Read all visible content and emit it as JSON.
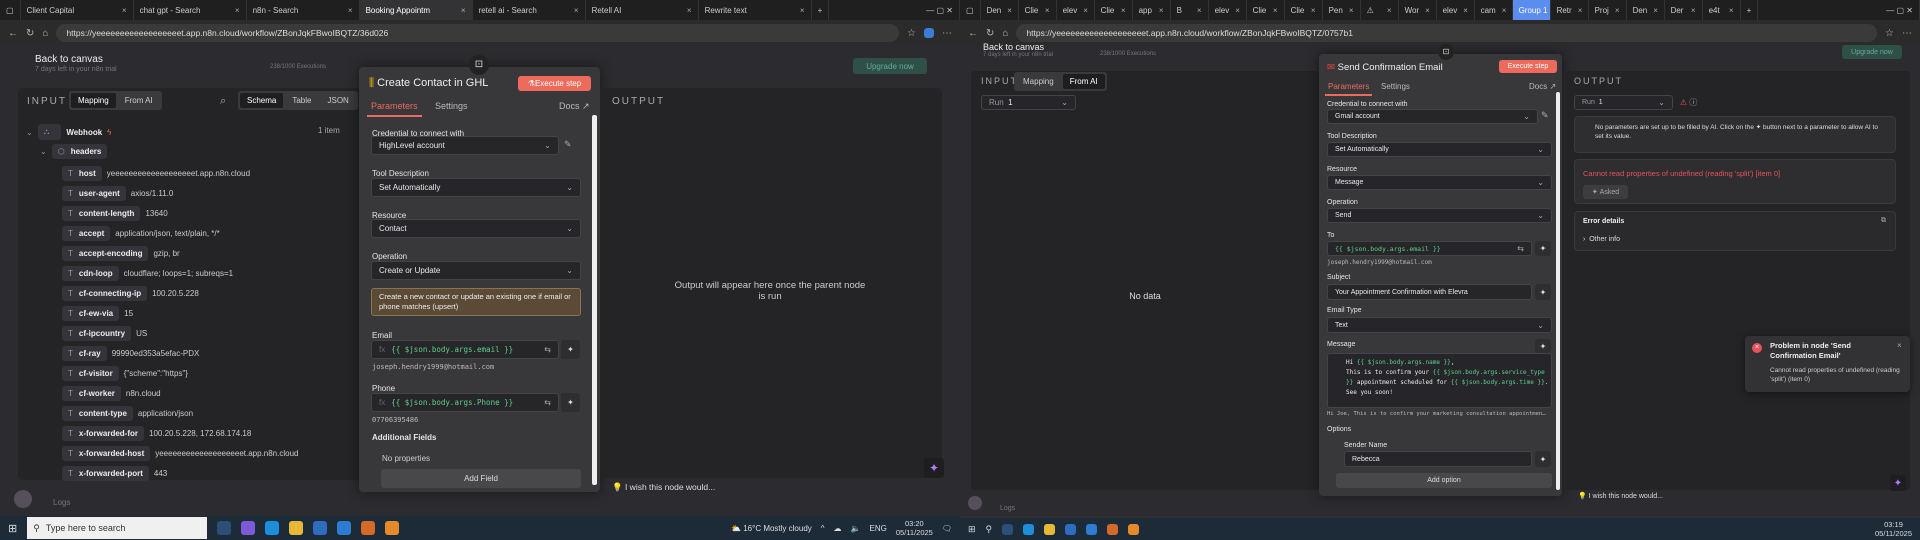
{
  "left": {
    "tabs": [
      {
        "label": "Client Capital"
      },
      {
        "label": "chat gpt - Search"
      },
      {
        "label": "n8n - Search"
      },
      {
        "label": "Booking Appointm"
      },
      {
        "label": "retell ai - Search"
      },
      {
        "label": "Retell AI"
      },
      {
        "label": "Rewrite text"
      }
    ],
    "url": "https://yeeeeeeeeeeeeeeeeeet.app.n8n.cloud/workflow/ZBonJqkFBwoIBQTZ/36d026",
    "back": "Back to canvas",
    "trial": "7 days left in your n8n trial",
    "executions": "238/1000 Executions",
    "upgrade": "Upgrade now",
    "input": {
      "title": "INPUT",
      "mapping": "Mapping",
      "from_ai": "From AI",
      "schema": "Schema",
      "table": "Table",
      "json": "JSON",
      "webhook": "Webhook",
      "items": "1 item",
      "headers": "headers",
      "rows": [
        [
          "host",
          "yeeeeeeeeeeeeeeeeeeet.app.n8n.cloud"
        ],
        [
          "user-agent",
          "axios/1.11.0"
        ],
        [
          "content-length",
          "13640"
        ],
        [
          "accept",
          "application/json, text/plain, */*"
        ],
        [
          "accept-encoding",
          "gzip, br"
        ],
        [
          "cdn-loop",
          "cloudflare; loops=1; subreqs=1"
        ],
        [
          "cf-connecting-ip",
          "100.20.5.228"
        ],
        [
          "cf-ew-via",
          "15"
        ],
        [
          "cf-ipcountry",
          "US"
        ],
        [
          "cf-ray",
          "99990ed353a5efac-PDX"
        ],
        [
          "cf-visitor",
          "{\"scheme\":\"https\"}"
        ],
        [
          "cf-worker",
          "n8n.cloud"
        ],
        [
          "content-type",
          "application/json"
        ],
        [
          "x-forwarded-for",
          "100.20.5.228, 172.68.174.18"
        ],
        [
          "x-forwarded-host",
          "yeeeeeeeeeeeeeeeeeeet.app.n8n.cloud"
        ],
        [
          "x-forwarded-port",
          "443"
        ]
      ]
    },
    "node": {
      "title": "Create Contact in GHL",
      "execute": "Execute step",
      "tab_params": "Parameters",
      "tab_settings": "Settings",
      "docs": "Docs",
      "cred_label": "Credential to connect with",
      "cred": "HighLevel account",
      "tool_label": "Tool Description",
      "tool": "Set Automatically",
      "resource_label": "Resource",
      "resource": "Contact",
      "op_label": "Operation",
      "op": "Create or Update",
      "notice": "Create a new contact or update an existing one if email or phone matches (upsert)",
      "email_label": "Email",
      "email_expr": "{{ $json.body.args.email }}",
      "email_hint": "joseph.hendry1999@hotmail.com",
      "phone_label": "Phone",
      "phone_expr": "{{ $json.body.args.Phone }}",
      "phone_hint": "07706395486",
      "additional": "Additional Fields",
      "no_props": "No properties",
      "add_field": "Add Field"
    },
    "output": {
      "title": "OUTPUT",
      "placeholder": "Output will appear here once the parent node is run",
      "wish": "I wish this node would..."
    },
    "logs": "Logs",
    "taskbar": {
      "search": "Type here to search",
      "weather": "16°C  Mostly cloudy",
      "lang": "ENG",
      "time": "03:20",
      "date": "05/11/2025"
    }
  },
  "right": {
    "tabs": [
      {
        "label": "Den"
      },
      {
        "label": "Clie"
      },
      {
        "label": "elev"
      },
      {
        "label": "Clie"
      },
      {
        "label": "app"
      },
      {
        "label": "B"
      },
      {
        "label": "elev"
      },
      {
        "label": "Clie"
      },
      {
        "label": "Clie"
      },
      {
        "label": "Pen"
      },
      {
        "label": "⚠"
      },
      {
        "label": "Wor"
      },
      {
        "label": "elev"
      },
      {
        "label": "cam"
      },
      {
        "label": "Group 1"
      },
      {
        "label": "Retr"
      },
      {
        "label": "Proj"
      },
      {
        "label": "Den"
      },
      {
        "label": "Der"
      },
      {
        "label": "e4t"
      }
    ],
    "url": "https://yeeeeeeeeeeeeeeeeeeet.app.n8n.cloud/workflow/ZBonJqkFBwoIBQTZ/0757b1",
    "back": "Back to canvas",
    "trial": "7 days left in your n8n trial",
    "executions": "238/1000 Executions",
    "upgrade": "Upgrade now",
    "input": {
      "title": "INPUT",
      "mapping": "Mapping",
      "from_ai": "From AI",
      "run_label": "Run",
      "run": "1",
      "no_data": "No data"
    },
    "node": {
      "title": "Send Confirmation Email",
      "execute": "Execute step",
      "tab_params": "Parameters",
      "tab_settings": "Settings",
      "docs": "Docs",
      "cred_label": "Credential to connect with",
      "cred": "Gmail account",
      "tool_label": "Tool Description",
      "tool": "Set Automatically",
      "resource_label": "Resource",
      "resource": "Message",
      "op_label": "Operation",
      "op": "Send",
      "to_label": "To",
      "to_expr": "{{ $json.body.args.email }}",
      "to_hint": "joseph.hendry1999@hotmail.com",
      "subject_label": "Subject",
      "subject": "Your Appointment Confirmation with Elevra",
      "type_label": "Email Type",
      "type": "Text",
      "message_label": "Message",
      "msg": {
        "l1a": "Hi ",
        "l1b": "{{ $json.body.args.name }}",
        "l1c": ",",
        "l2a": "This is to confirm your ",
        "l2b": "{{ $json.body.args.service_type",
        "l3a": "}}",
        "l3b": " appointment scheduled for ",
        "l3c": "{{ $json.body.args.time }}",
        "l3d": ".",
        "l4": "See you soon!"
      },
      "message_hint": "Hi Joe, This is to confirm your marketing consultation appointmen…",
      "options": "Options",
      "sender_label": "Sender Name",
      "sender": "Rebecca",
      "add_option": "Add option"
    },
    "output": {
      "title": "OUTPUT",
      "run_label": "Run",
      "run": "1",
      "info": "No parameters are set up to be filled by AI. Click on the  ✦  button next to a parameter to allow AI to set its value.",
      "error": "Cannot read properties of undefined (reading 'split') [item 0]",
      "asked": "Asked",
      "details": "Error details",
      "other": "Other info",
      "wish": "I wish this node would..."
    },
    "toast": {
      "title": "Problem in node 'Send Confirmation Email'",
      "body": "Cannot read properties of undefined (reading 'split') (item 0)"
    },
    "logs": "Logs",
    "taskbar": {
      "time": "03:19",
      "date": "05/11/2025"
    }
  },
  "colors": {
    "accent": "#ee6a5c",
    "expr": "#5fd08a",
    "error": "#e5535a"
  }
}
